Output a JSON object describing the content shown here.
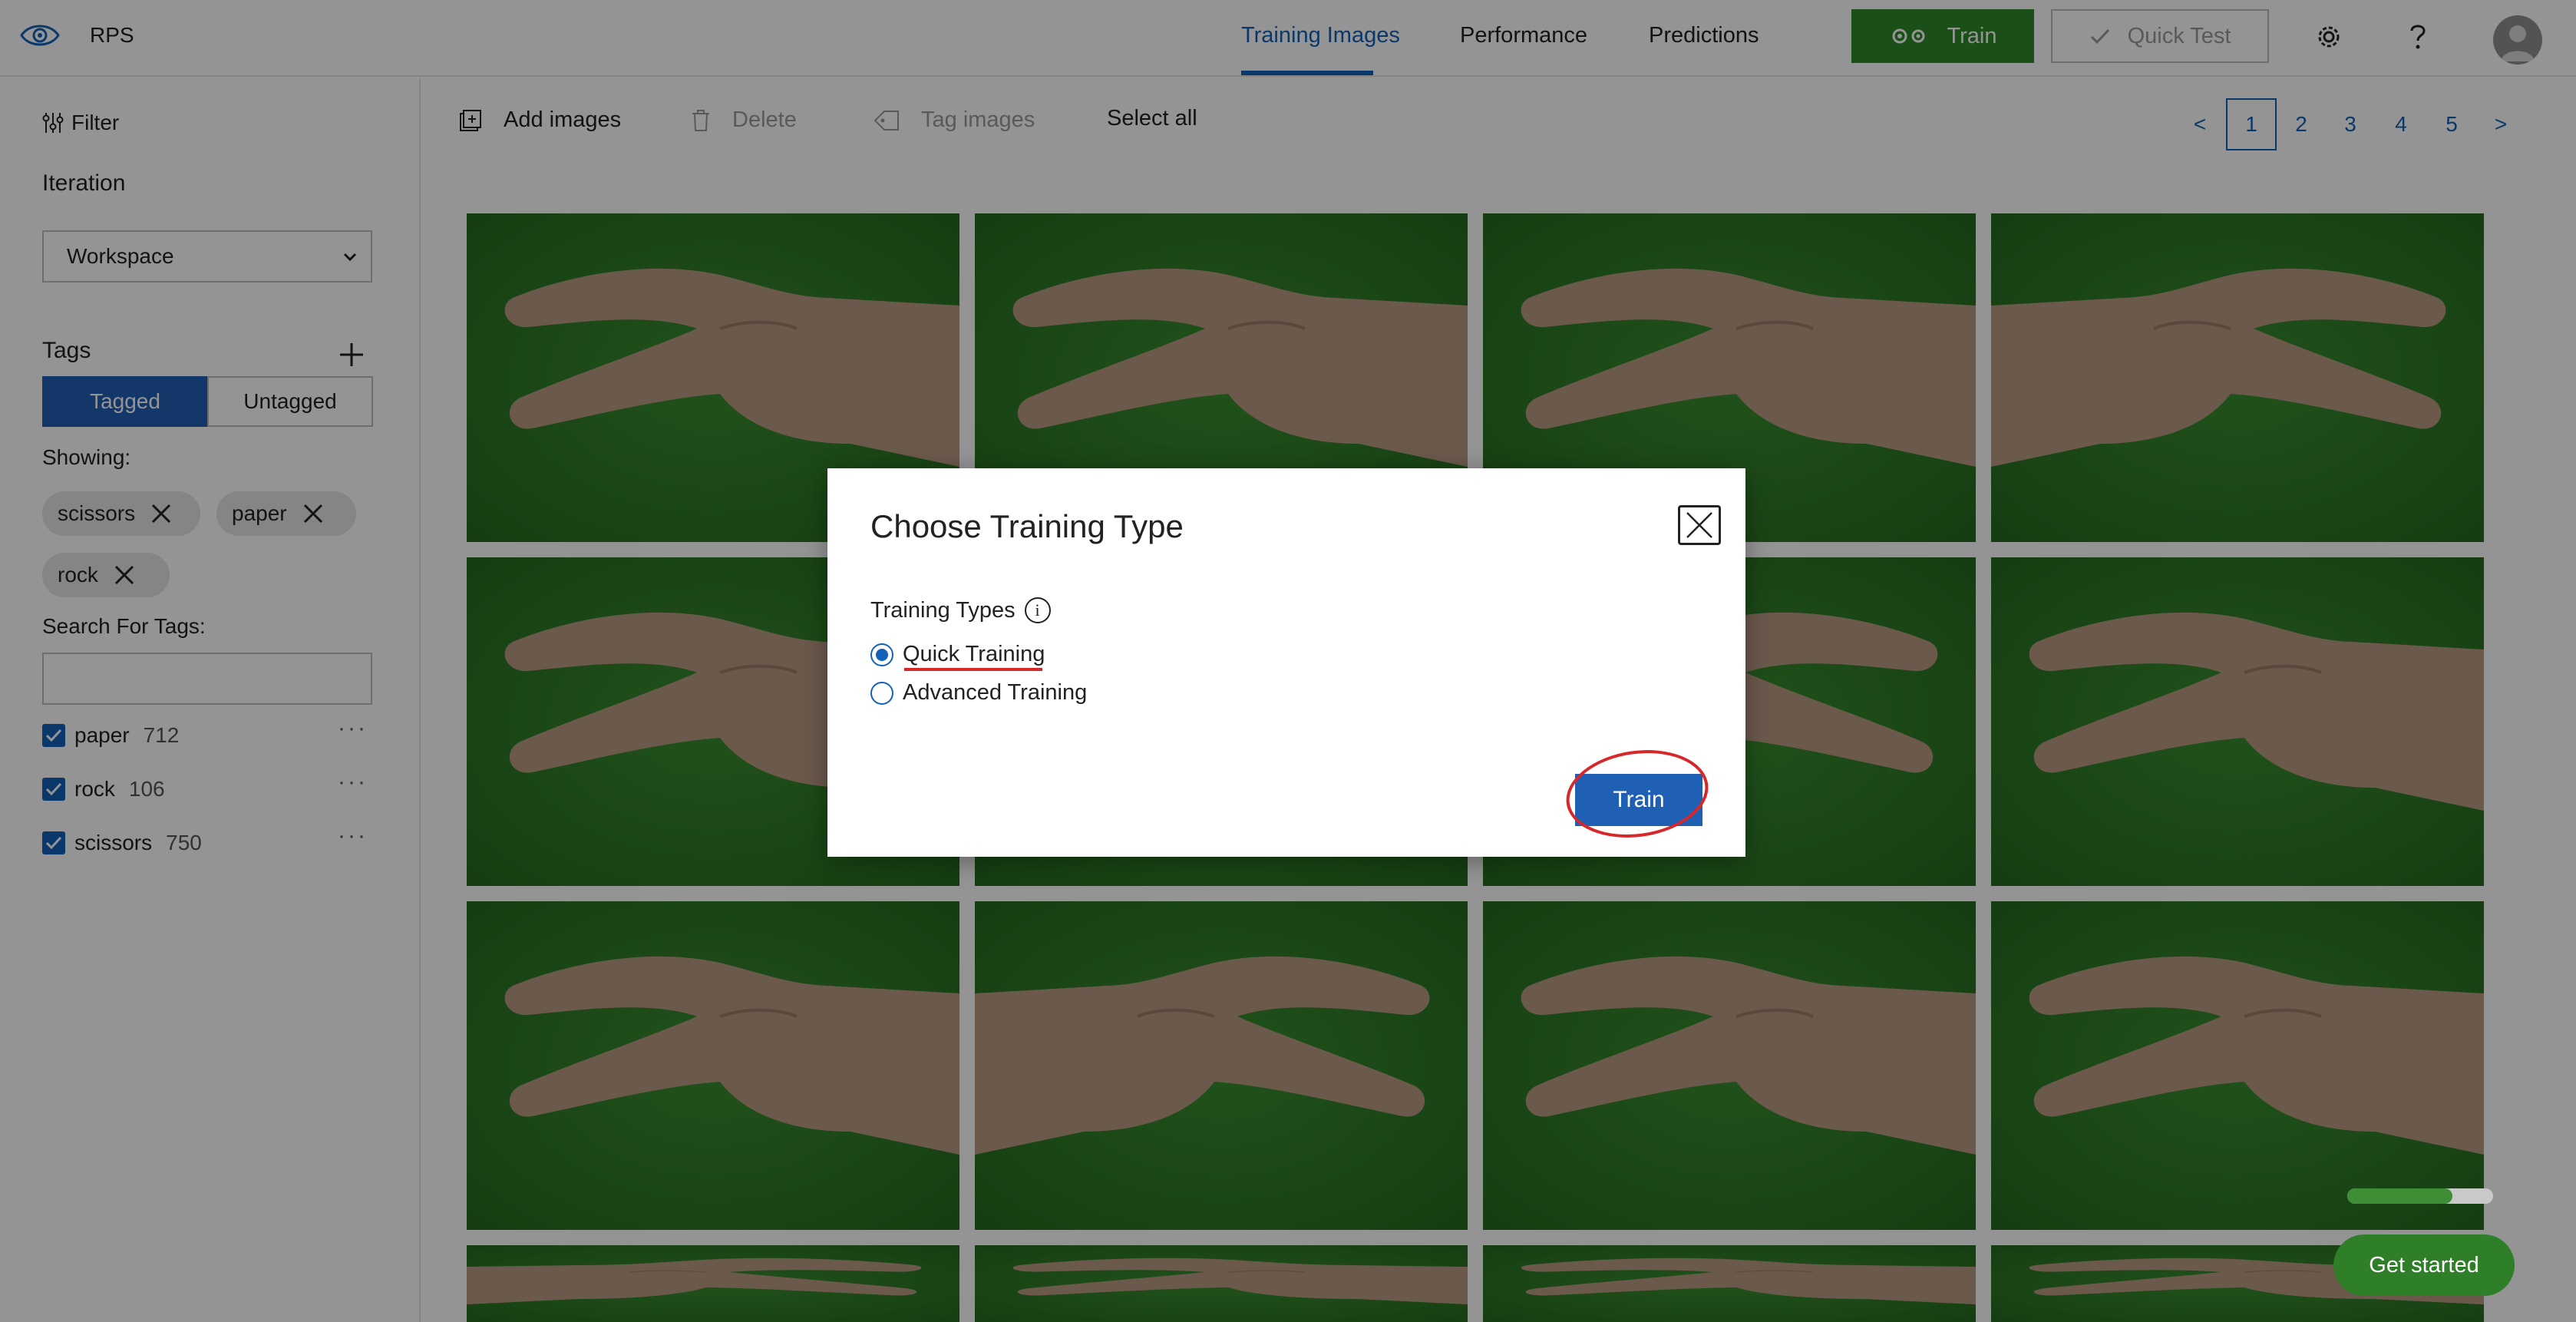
{
  "header": {
    "app_name": "RPS",
    "tabs": [
      {
        "label": "Training Images",
        "active": true
      },
      {
        "label": "Performance",
        "active": false
      },
      {
        "label": "Predictions",
        "active": false
      }
    ],
    "train_label": "Train",
    "quick_test_label": "Quick Test"
  },
  "sidebar": {
    "filter_label": "Filter",
    "iteration_heading": "Iteration",
    "iteration_value": "Workspace",
    "tags_heading": "Tags",
    "toggle": {
      "tagged": "Tagged",
      "untagged": "Untagged"
    },
    "showing_label": "Showing:",
    "chips": [
      "scissors",
      "paper",
      "rock"
    ],
    "search_label": "Search For Tags:",
    "search_value": "",
    "tags": [
      {
        "name": "paper",
        "count": "712",
        "checked": true
      },
      {
        "name": "rock",
        "count": "106",
        "checked": true
      },
      {
        "name": "scissors",
        "count": "750",
        "checked": true
      }
    ]
  },
  "toolbar": {
    "add_images": "Add images",
    "delete": "Delete",
    "tag_images": "Tag images",
    "select_all": "Select all"
  },
  "pagination": {
    "prev": "<",
    "pages": [
      "1",
      "2",
      "3",
      "4",
      "5"
    ],
    "current": "1",
    "next": ">"
  },
  "dialog": {
    "title": "Choose Training Type",
    "types_label": "Training Types",
    "info_glyph": "i",
    "options": [
      {
        "label": "Quick Training",
        "selected": true
      },
      {
        "label": "Advanced Training",
        "selected": false
      }
    ],
    "train_button": "Train"
  },
  "progress": {
    "fraction": 0.72
  },
  "get_started": "Get started",
  "colors": {
    "accent_blue": "#1461b8",
    "train_green": "#2e8b2a",
    "annotation_red": "#d6282a",
    "image_background_green": "#2f7a26"
  }
}
